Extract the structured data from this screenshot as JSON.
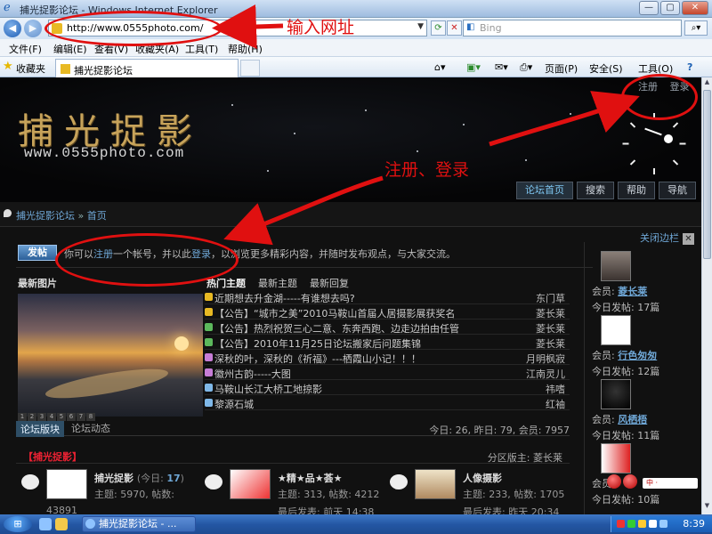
{
  "window": {
    "title": "捕光捉影论坛 - Windows Internet Explorer",
    "min": "—",
    "max": "▢",
    "close": "✕"
  },
  "browser": {
    "url": "http://www.0555photo.com/",
    "search_placeholder": "Bing",
    "menu": [
      "文件(F)",
      "编辑(E)",
      "查看(V)",
      "收藏夹(A)",
      "工具(T)",
      "帮助(H)"
    ],
    "favorites": "收藏夹",
    "tab_title": "捕光捉影论坛",
    "toolbar": {
      "page": "页面(P)",
      "safety": "安全(S)",
      "tools": "工具(O)",
      "help": "?"
    }
  },
  "site": {
    "logo_cn": "捕光捉影",
    "logo_en": "www.0555photo.com",
    "top_links": [
      "注册",
      "登录"
    ],
    "nav": [
      "论坛首页",
      "搜索",
      "帮助",
      "导航"
    ],
    "breadcrumb": [
      "捕光捉影论坛",
      "»",
      "首页"
    ],
    "close_sidebar": "关闭边栏",
    "post_button": "发帖",
    "welcome": {
      "pre": "你可以",
      "register": "注册",
      "mid": "一个帐号，并以此",
      "login": "登录",
      "post": "，以浏览更多精彩内容，并随时发布观点，与大家交流。"
    }
  },
  "latest_pics": {
    "title": "最新图片",
    "pages": [
      "1",
      "2",
      "3",
      "4",
      "5",
      "6",
      "7",
      "8"
    ]
  },
  "hot": {
    "tabs": [
      "热门主题",
      "最新主题",
      "最新回复"
    ],
    "rows": [
      {
        "title": "近期想去升金湖-----有谁想去吗?",
        "author": "东门草",
        "color": "#e8b923"
      },
      {
        "title": "【公告】“城市之美”2010马鞍山首届人居摄影展获奖名",
        "author": "菱长莱",
        "color": "#e8b923"
      },
      {
        "title": "【公告】热烈祝贺三心二意、东奔西跑、边走边拍由任管",
        "author": "菱长莱",
        "color": "#5cb85c"
      },
      {
        "title": "【公告】2010年11月25日论坛搬家后问题集锦",
        "author": "菱长莱",
        "color": "#5cb85c"
      },
      {
        "title": "深秋的叶，深秋的《祈福》---栖霞山小记！！！",
        "author": "月明枫寂",
        "color": "#c77dd6"
      },
      {
        "title": "徽州古韵-----大图",
        "author": "江南灵儿",
        "color": "#c77dd6"
      },
      {
        "title": "马鞍山长江大桥工地掠影",
        "author": "祎嗜",
        "color": "#7fb8e8"
      },
      {
        "title": "黎源石城",
        "author": "红袖",
        "color": "#7fb8e8"
      }
    ]
  },
  "forum_tabs": [
    "论坛版块",
    "论坛动态"
  ],
  "stats": "今日: 26, 昨日: 79, 会员: 7957",
  "category": {
    "name": "【捕光捉影】",
    "moderator": "分区版主: 菱长莱"
  },
  "forums": [
    {
      "name": "捕光捉影",
      "today_label": "(今日:",
      "today": "17",
      "close": ")",
      "stats": "主题: 5970, 帖数:",
      "extra": "43891",
      "last": ""
    },
    {
      "name": "★精★品★荟★",
      "today_label": "",
      "today": "",
      "close": "",
      "stats": "主题: 313, 帖数: 4212",
      "extra": "",
      "last": "最后发表: 前天 14:38"
    },
    {
      "name": "人像摄影",
      "today_label": "",
      "today": "",
      "close": "",
      "stats": "主题: 233, 帖数: 1705",
      "extra": "",
      "last": "最后发表: 昨天 20:34"
    }
  ],
  "members": [
    {
      "label": "会员:",
      "name": "菱长莱",
      "posts": "今日发帖: 17篇"
    },
    {
      "label": "会员:",
      "name": "行色匆匆",
      "posts": "今日发帖: 12篇"
    },
    {
      "label": "会员:",
      "name": "风栖梧",
      "posts": "今日发帖: 11篇"
    },
    {
      "label": "会员:",
      "name": "",
      "posts": "今日发帖: 10篇"
    }
  ],
  "annotations": {
    "address": "输入网址",
    "register_login": "注册、登录"
  },
  "taskbar": {
    "task": "捕光捉影论坛 - ...",
    "time": "8:39",
    "widget": "中 ·"
  }
}
